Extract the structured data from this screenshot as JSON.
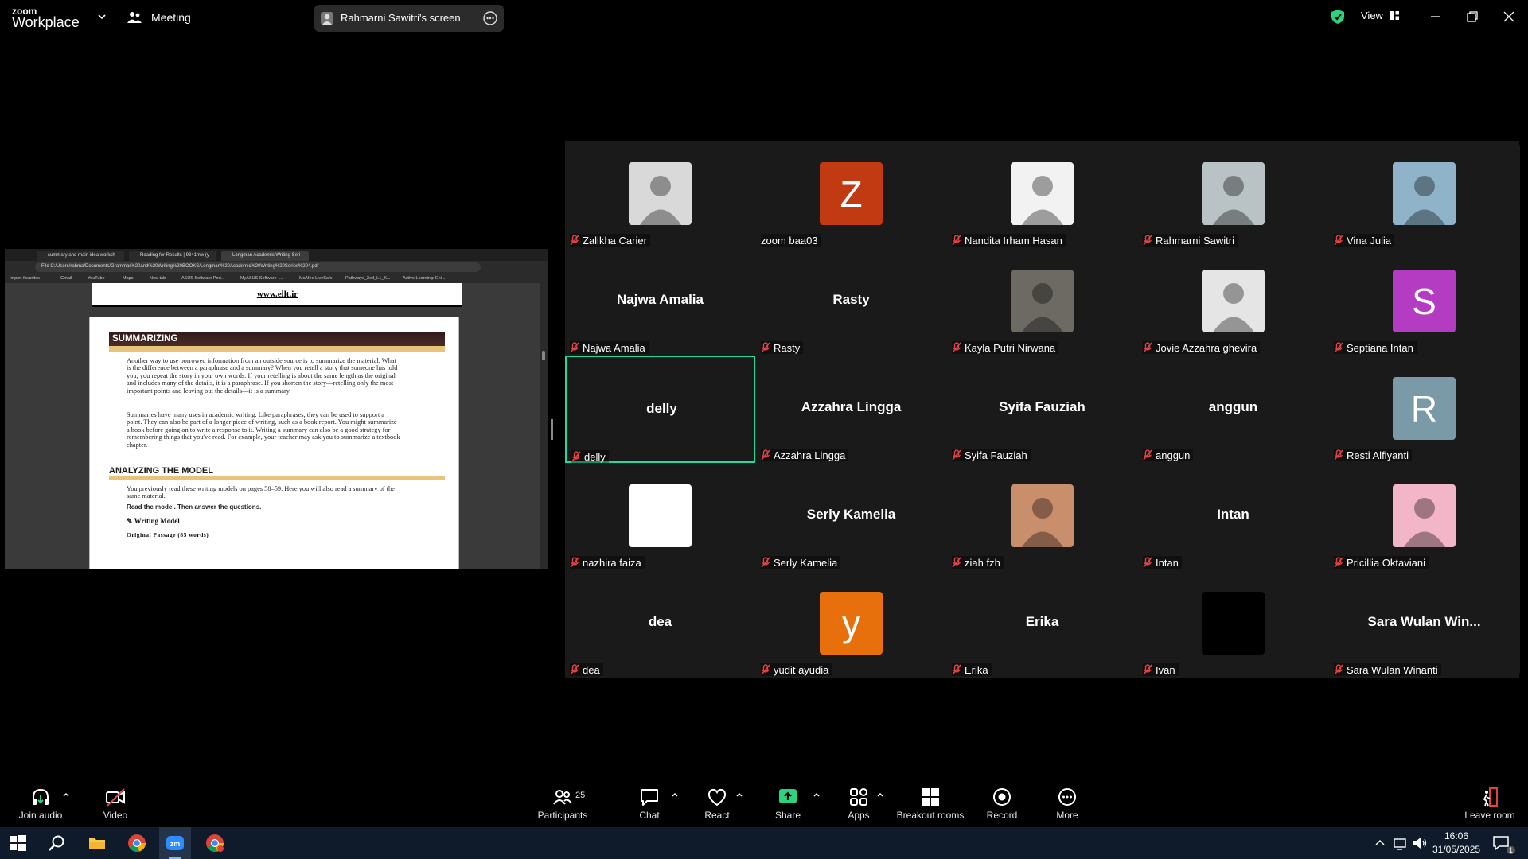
{
  "titlebar": {
    "brand": "zoom",
    "product": "Workplace",
    "meeting_label": "Meeting",
    "screen_share_label": "Rahmarni Sawitri's screen",
    "view_label": "View"
  },
  "shared_screen": {
    "browser_tabs": [
      "summary and main idea worksh",
      "Reading for Results | 9341mw (y",
      "Longman Academic Writing Seri"
    ],
    "address": "File  C:/Users/rahma/Documents/Grammar%20and%20Writing%20BOOKS/Longman%20Academic%20Writing%20Series%204.pdf",
    "bookmarks": [
      "Import favorites",
      "Gmail",
      "YouTube",
      "Maps",
      "New tab",
      "ASUS Software Port...",
      "MyASUS Software -...",
      "McAfee LiveSafe",
      "Pathways_2ed_L1_K...",
      "Active Learning: Eni..."
    ],
    "pdf": {
      "site_url": "www.ellt.ir",
      "section1_title": "SUMMARIZING",
      "para1": "Another way to use borrowed information from an outside source is to summarize the material. What is the difference between a paraphrase and a summary? When you retell a story that someone has told you, you repeat the story in your own words. If your retelling is about the same length as the original and includes many of the details, it is a paraphrase. If you shorten the story—retelling only the most important points and leaving out the details—it is a summary.",
      "para2": "Summaries have many uses in academic writing. Like paraphrases, they can be used to support a point. They can also be part of a longer piece of writing, such as a book report. You might summarize a book before going on to write a response to it. Writing a summary can also be a good strategy for remembering things that you've read. For example, your teacher may ask you to summarize a textbook chapter.",
      "section2_title": "ANALYZING THE MODEL",
      "para3": "You previously read these writing models on pages 58–59. Here you will also read a summary of the same material.",
      "instruction": "Read the model. Then answer the questions.",
      "model_label": "Writing Model",
      "original_label": "Original Passage (85 words)"
    }
  },
  "participants": [
    {
      "name": "Zalikha Carier",
      "avatar": "photo",
      "color": "#d9d9d9",
      "muted": true
    },
    {
      "name": "zoom baa03",
      "avatar": "letter",
      "letter": "Z",
      "color": "#c23a12",
      "muted": false
    },
    {
      "name": "Nandita Irham Hasan",
      "avatar": "photo",
      "color": "#f2f2f2",
      "muted": true
    },
    {
      "name": "Rahmarni Sawitri",
      "avatar": "photo",
      "color": "#b9c2c5",
      "muted": true
    },
    {
      "name": "Vina Julia",
      "avatar": "photo",
      "color": "#8fb3c9",
      "muted": true
    },
    {
      "name": "Najwa Amalia",
      "avatar": "none",
      "big": "Najwa Amalia",
      "muted": true
    },
    {
      "name": "Rasty",
      "avatar": "none",
      "big": "Rasty",
      "muted": true
    },
    {
      "name": "Kayla Putri Nirwana",
      "avatar": "photo",
      "color": "#6d6a63",
      "muted": true
    },
    {
      "name": "Jovie Azzahra ghevira",
      "avatar": "photo",
      "color": "#e5e5e5",
      "muted": true
    },
    {
      "name": "Septiana Intan",
      "avatar": "letter",
      "letter": "S",
      "color": "#b33cc2",
      "muted": true
    },
    {
      "name": "delly",
      "avatar": "none",
      "big": "delly",
      "muted": true,
      "active": true
    },
    {
      "name": "Azzahra Lingga",
      "avatar": "none",
      "big": "Azzahra Lingga",
      "muted": true
    },
    {
      "name": "Syifa Fauziah",
      "avatar": "none",
      "big": "Syifa Fauziah",
      "muted": true
    },
    {
      "name": "anggun",
      "avatar": "none",
      "big": "anggun",
      "muted": true
    },
    {
      "name": "Resti Alfiyanti",
      "avatar": "letter",
      "letter": "R",
      "color": "#7a9aa8",
      "muted": true
    },
    {
      "name": "nazhira faiza",
      "avatar": "photo",
      "color": "#ffffff",
      "muted": true
    },
    {
      "name": "Serly Kamelia",
      "avatar": "none",
      "big": "Serly Kamelia",
      "muted": true
    },
    {
      "name": "ziah fzh",
      "avatar": "photo",
      "color": "#c98f6d",
      "muted": true
    },
    {
      "name": "Intan",
      "avatar": "none",
      "big": "Intan",
      "muted": true
    },
    {
      "name": "Pricillia Oktaviani",
      "avatar": "photo",
      "color": "#f2b6c8",
      "muted": true
    },
    {
      "name": "dea",
      "avatar": "none",
      "big": "dea",
      "muted": true
    },
    {
      "name": "yudit ayudia",
      "avatar": "letter",
      "letter": "y",
      "color": "#e8700c",
      "muted": true
    },
    {
      "name": "Erika",
      "avatar": "none",
      "big": "Erika",
      "muted": true
    },
    {
      "name": "Ivan",
      "avatar": "photo",
      "color": "#000000",
      "muted": true
    },
    {
      "name": "Sara Wulan Winanti",
      "avatar": "none",
      "big": "Sara Wulan Win...",
      "muted": true
    }
  ],
  "toolbar": {
    "join_audio": "Join audio",
    "video": "Video",
    "participants": "Participants",
    "participants_count": "25",
    "chat": "Chat",
    "react": "React",
    "share": "Share",
    "apps": "Apps",
    "breakout": "Breakout rooms",
    "record": "Record",
    "more": "More",
    "leave": "Leave room"
  },
  "taskbar": {
    "time": "16:06",
    "date": "31/05/2025",
    "notification_count": "1"
  },
  "colors": {
    "active_speaker": "#23d9a2",
    "share_green": "#2bd37e",
    "muted_red": "#e04343"
  }
}
